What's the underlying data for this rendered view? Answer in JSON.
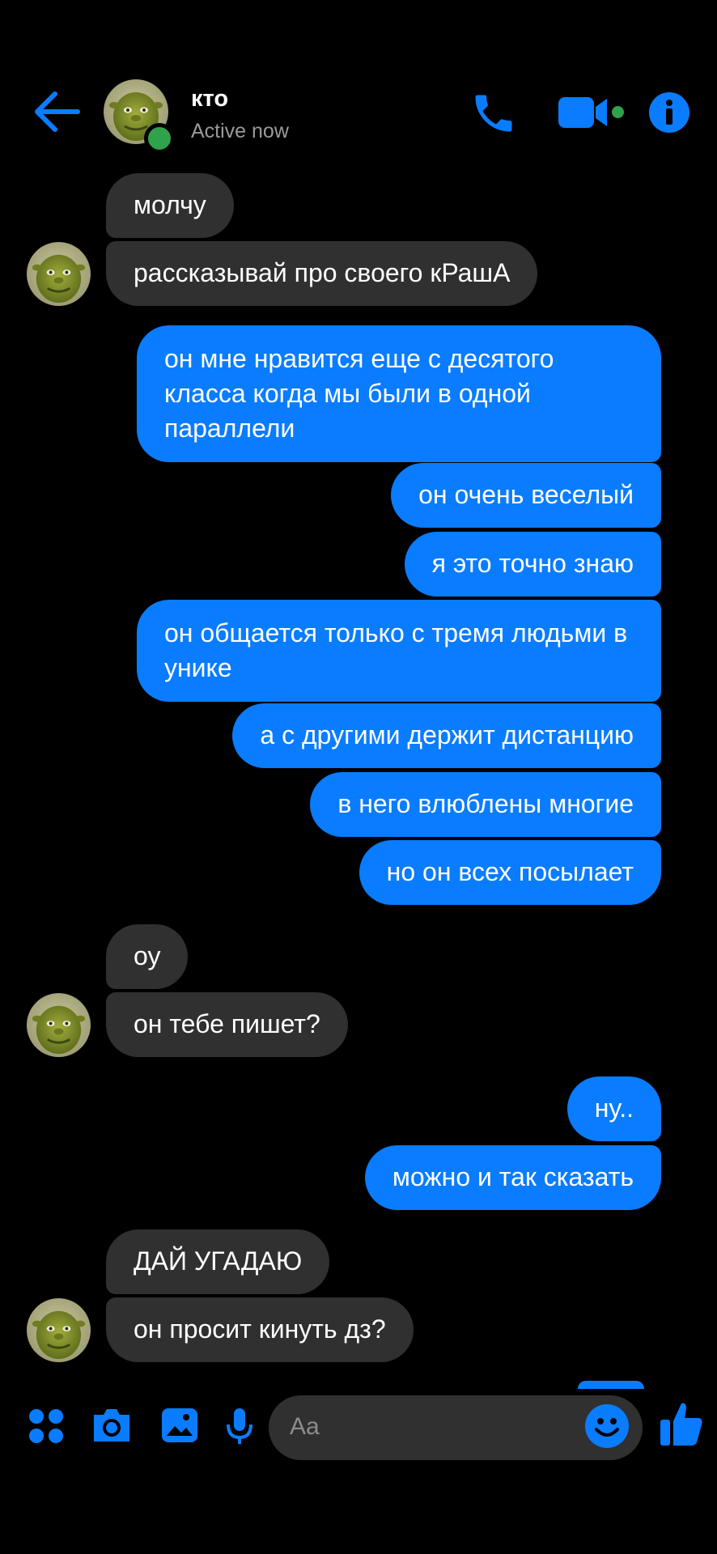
{
  "colors": {
    "accent": "#0a7cff",
    "incoming_bubble": "#303030",
    "online": "#31a24c",
    "background": "#000000"
  },
  "header": {
    "contact_name": "кто",
    "status": "Active now",
    "icons": [
      "back-arrow-icon",
      "phone-icon",
      "video-camera-icon",
      "info-icon"
    ]
  },
  "messages": [
    {
      "side": "in",
      "text": "молчу"
    },
    {
      "side": "in",
      "text": "рассказывай про своего кРашА"
    },
    {
      "side": "out",
      "text": "он мне нравится еще с десятого класса когда мы были в одной параллели"
    },
    {
      "side": "out",
      "text": "он очень веселый"
    },
    {
      "side": "out",
      "text": "я это точно знаю"
    },
    {
      "side": "out",
      "text": "он общается только с тремя людьми в унике"
    },
    {
      "side": "out",
      "text": "а с другими держит дистанцию"
    },
    {
      "side": "out",
      "text": "в него влюблены многие"
    },
    {
      "side": "out",
      "text": "но он всех посылает"
    },
    {
      "side": "in",
      "text": "оу"
    },
    {
      "side": "in",
      "text": "он тебе пишет?"
    },
    {
      "side": "out",
      "text": "ну.."
    },
    {
      "side": "out",
      "text": "можно и так сказать"
    },
    {
      "side": "in",
      "text": "ДАЙ УГАДАЮ"
    },
    {
      "side": "in",
      "text": "он просит кинуть дз?"
    }
  ],
  "composer": {
    "placeholder": "Aa",
    "icons": [
      "apps-grid-icon",
      "camera-icon",
      "gallery-icon",
      "microphone-icon",
      "emoji-icon",
      "thumbs-up-icon"
    ]
  }
}
